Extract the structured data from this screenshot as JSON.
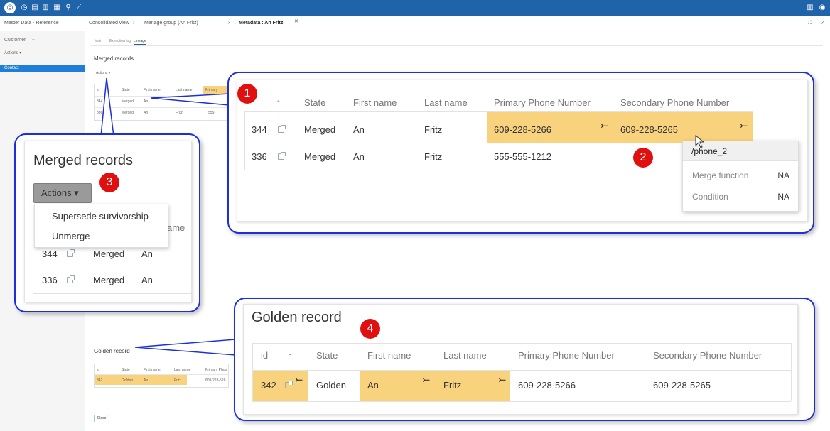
{
  "topbar": {
    "logo": "◎",
    "icons": [
      "history-icon",
      "doc-icon",
      "docs-icon",
      "docs-alt-icon",
      "pin-icon",
      "tool-icon"
    ],
    "glyphs": [
      "◷",
      "▤",
      "▥",
      "▦",
      "⚲",
      "⟋"
    ],
    "right_icons": [
      "▥",
      "◉"
    ]
  },
  "tabs": {
    "app": "Master Data - Reference",
    "t1": "Consolidated view",
    "sep1": "›",
    "t2": "Manage group (An Fritz)",
    "sep2": "›",
    "t3": "Metadata : An Fritz",
    "close": "✕",
    "right1": "⛶",
    "right2": "?"
  },
  "sidebar": {
    "entity": "Customer",
    "entity_arrow": "⌄",
    "actions": "Actions ▾",
    "active_item": "Contact"
  },
  "page": {
    "subtabs": [
      "Main",
      "Execution log",
      "Lineage"
    ],
    "merged_title": "Merged records",
    "actions_small": "Actions ▾",
    "golden_title": "Golden record",
    "close_button": "Close"
  },
  "bg_merged": {
    "headers": [
      "id",
      "State",
      "First name",
      "Last name",
      "Primary"
    ],
    "rows": [
      [
        "344",
        "Merged",
        "An"
      ],
      [
        "336",
        "Merged",
        "An",
        "Fritz",
        "555-"
      ]
    ]
  },
  "bg_golden": {
    "headers": [
      "id",
      "State",
      "First name",
      "Last name",
      "Primary Phon"
    ],
    "row": [
      "342",
      "Golden",
      "An",
      "Fritz",
      "609-228-526"
    ]
  },
  "callout1": {
    "badge": "1",
    "headers": [
      "State",
      "First name",
      "Last name",
      "Primary Phone Number",
      "Secondary Phone Number"
    ],
    "sort": "⌃",
    "rows": [
      {
        "id": "344",
        "state": "Merged",
        "first": "An",
        "last": "Fritz",
        "primary": "609-228-5266",
        "secondary": "609-228-5265"
      },
      {
        "id": "336",
        "state": "Merged",
        "first": "An",
        "last": "Fritz",
        "primary": "555-555-1212",
        "secondary": ""
      }
    ],
    "merge_glyph": "⤚"
  },
  "callout2": {
    "badge": "2",
    "popup_title": "/phone_2",
    "merge_function_label": "Merge function",
    "merge_function_value": "NA",
    "condition_label": "Condition",
    "condition_value": "NA"
  },
  "callout3": {
    "badge": "3",
    "title": "Merged records",
    "actions": "Actions ▾",
    "menu": [
      "Supersede survivorship",
      "Unmerge"
    ],
    "hidden_header_fragment": "ame",
    "rows": [
      {
        "id": "344",
        "state": "Merged",
        "first": "An"
      },
      {
        "id": "336",
        "state": "Merged",
        "first": "An"
      }
    ]
  },
  "callout4": {
    "badge": "4",
    "title": "Golden record",
    "headers": [
      "id",
      "State",
      "First name",
      "Last name",
      "Primary Phone Number",
      "Secondary Phone Number"
    ],
    "sort": "⌃",
    "row": {
      "id": "342",
      "state": "Golden",
      "first": "An",
      "last": "Fritz",
      "primary": "609-228-5266",
      "secondary": "609-228-5265"
    }
  },
  "colors": {
    "topbar": "#1f63a8",
    "callout_border": "#1e2fd6",
    "badge": "#e01010",
    "highlight": "#f9d27e"
  }
}
